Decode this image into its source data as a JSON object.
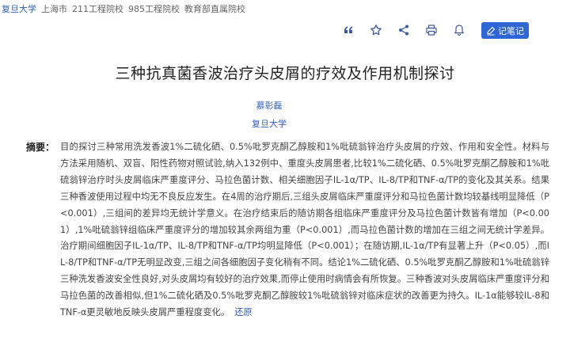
{
  "topbar": {
    "institution": "复旦大学",
    "tags": [
      "上海市",
      "211工程院校",
      "985工程院校",
      "教育部直属院校"
    ]
  },
  "toolbar": {
    "icons": [
      "quote-icon",
      "star-icon",
      "share-icon",
      "print-icon",
      "bell-icon"
    ],
    "note_label": "记笔记"
  },
  "article": {
    "title": "三种抗真菌香波治疗头皮屑的疗效及作用机制探讨",
    "author": "慕彰磊",
    "affiliation": "复旦大学",
    "abstract_label": "摘要：",
    "abstract_text": "目的探讨三种常用洗发香波1%二硫化硒、0.5%吡罗克酮乙醇胺和1%吡硫翁锌治疗头皮屑的疗效、作用和安全性。材料与方法采用随机、双盲、阳性药物对照试验,纳入132例中、重度头皮屑患者,比较1%二硫化硒、0.5%吡罗克酮乙醇胺和1%吡硫翁锌治疗时头皮屑临床严重度评分、马拉色菌计数、相关细胞因子IL-1α/TP、IL-8/TP和TNF-α/TP的变化及其关系。结果三种香波使用过程中均无不良反应发生。在4周的治疗期后,三组头皮屑临床严重度评分和马拉色菌计数均较基线明显降低（P<0.001）,三组间的差异均无统计学意义。在治疗结束后的随访期各组临床严重度评分及马拉色菌计数皆有增加（P<0.001）,1%吡硫翁锌组临床严重度评分的增加较其余两组为重（P<0.001）,而马拉色菌计数的增加在三组之间无统计学差异。治疗期间细胞因子IL-1α/TP、IL-8/TP和TNF-α/TP均明显降低（P<0.001）；在随访期,IL-1α/TP有显著上升（P<0.05）,而IL-8/TP和TNF-α/TP无明显改变,三组之间各细胞因子变化稍有不同。结论1%二硫化硒、0.5%吡罗克酮乙醇胺和1%吡硫翁锌三种洗发香波安全性良好,对头皮屑均有较好的治疗效果,而停止使用时病情会有所恢复。三种香波对头皮屑临床严重度评分和马拉色菌的改善相似,但1%二硫化硒及0.5%吡罗克酮乙醇胺较1%吡硫翁锌对临床症状的改善更为持久。IL-1α能够较IL-8和TNF-α更灵敏地反映头皮屑严重程度变化。",
    "collapse_label": "还原"
  },
  "colors": {
    "link": "#2f5eb5",
    "accent": "#2f66d6",
    "icon": "#3a5a9c"
  }
}
